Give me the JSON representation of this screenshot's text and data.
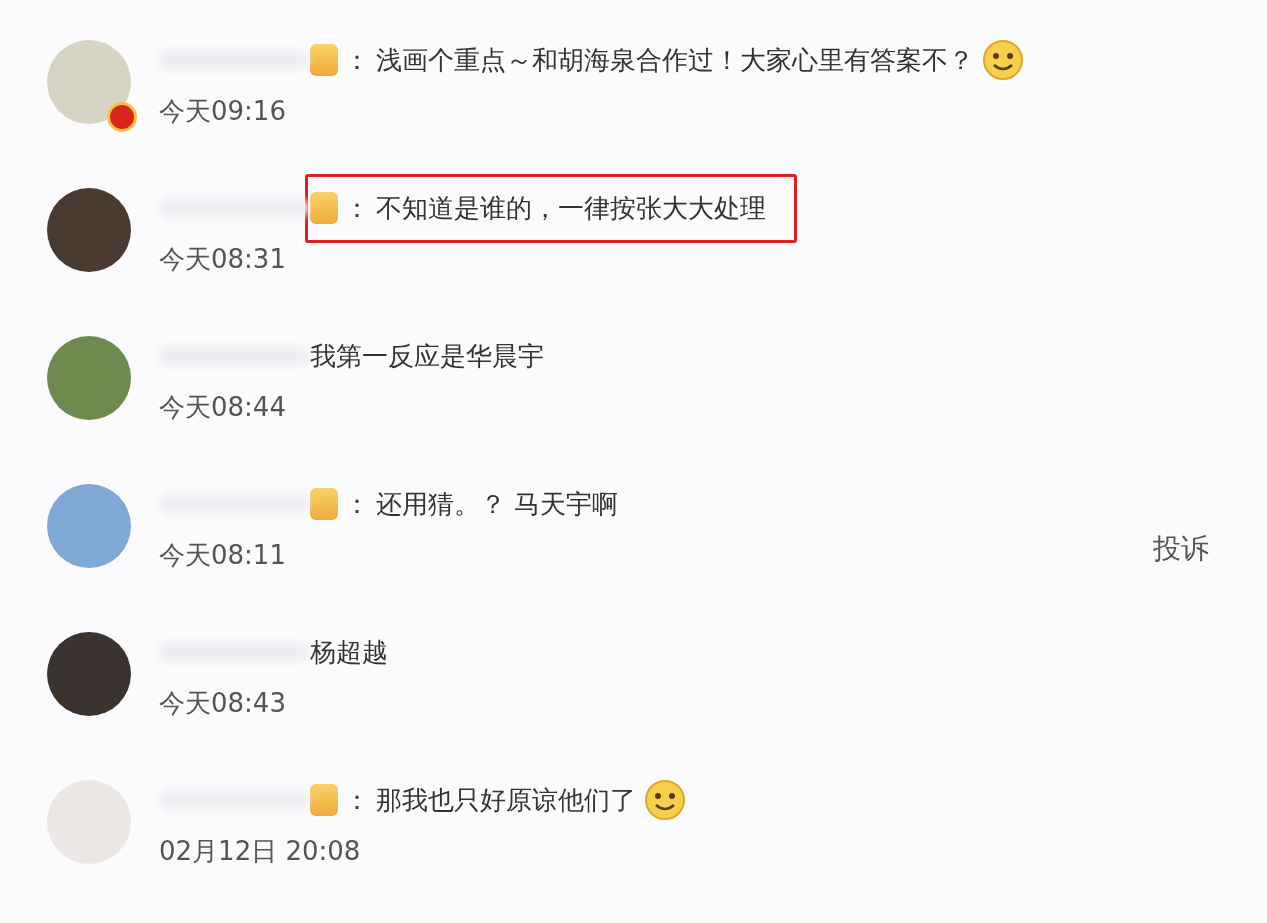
{
  "comments": [
    {
      "verified": true,
      "badge": true,
      "separator": "：",
      "text": "浅画个重点～和胡海泉合作过！大家心里有答案不？",
      "emoji": true,
      "highlighted": false,
      "time": "今天09:16"
    },
    {
      "verified": false,
      "badge": true,
      "separator": "：",
      "text": "不知道是谁的，一律按张大大处理",
      "emoji": false,
      "highlighted": true,
      "time": "今天08:31"
    },
    {
      "verified": false,
      "badge": false,
      "text": "我第一反应是华晨宇",
      "emoji": false,
      "highlighted": false,
      "time": "今天08:44"
    },
    {
      "verified": false,
      "badge": true,
      "separator": "：",
      "text": "还用猜。？ 马天宇啊",
      "emoji": false,
      "highlighted": false,
      "time": "今天08:11",
      "action": "投诉"
    },
    {
      "verified": false,
      "badge": false,
      "text": "杨超越",
      "emoji": false,
      "highlighted": false,
      "time": "今天08:43"
    },
    {
      "verified": false,
      "badge": true,
      "separator": "：",
      "text": "那我也只好原谅他们了",
      "emoji": true,
      "highlighted": false,
      "time": "02月12日 20:08"
    }
  ]
}
